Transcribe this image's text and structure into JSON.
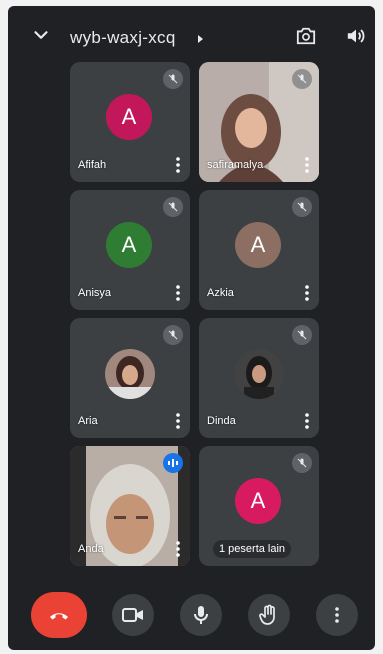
{
  "meeting": {
    "code": "wyb-waxj-xcq"
  },
  "participants": [
    {
      "name": "Afifah",
      "initial": "A",
      "avatar_color": "#c2185b",
      "type": "initial",
      "mic": "muted"
    },
    {
      "name": "safiramalya",
      "type": "video",
      "mic": "muted"
    },
    {
      "name": "Anisya",
      "initial": "A",
      "avatar_color": "#2e7d32",
      "type": "initial",
      "mic": "muted"
    },
    {
      "name": "Azkia",
      "initial": "A",
      "avatar_color": "#8d6e63",
      "type": "initial",
      "mic": "muted"
    },
    {
      "name": "Aria",
      "type": "photo",
      "mic": "muted"
    },
    {
      "name": "Dinda",
      "type": "photo",
      "mic": "muted"
    },
    {
      "name": "Anda",
      "type": "video",
      "mic": "speaking"
    },
    {
      "name": "1 peserta lain",
      "initial": "A",
      "avatar_color": "#d81b60",
      "type": "initial",
      "mic": "muted"
    }
  ],
  "icons": {
    "collapse": "chevron-down-icon",
    "switch_camera": "camera-switch-icon",
    "audio_output": "speaker-icon",
    "end_call": "phone-hangup-icon",
    "camera": "video-camera-icon",
    "mic": "microphone-icon",
    "raise_hand": "hand-icon",
    "more": "more-vert-icon"
  },
  "colors": {
    "background": "#202124",
    "tile": "#3c4043",
    "end_call": "#ea4335",
    "speaking": "#1a73e8"
  }
}
